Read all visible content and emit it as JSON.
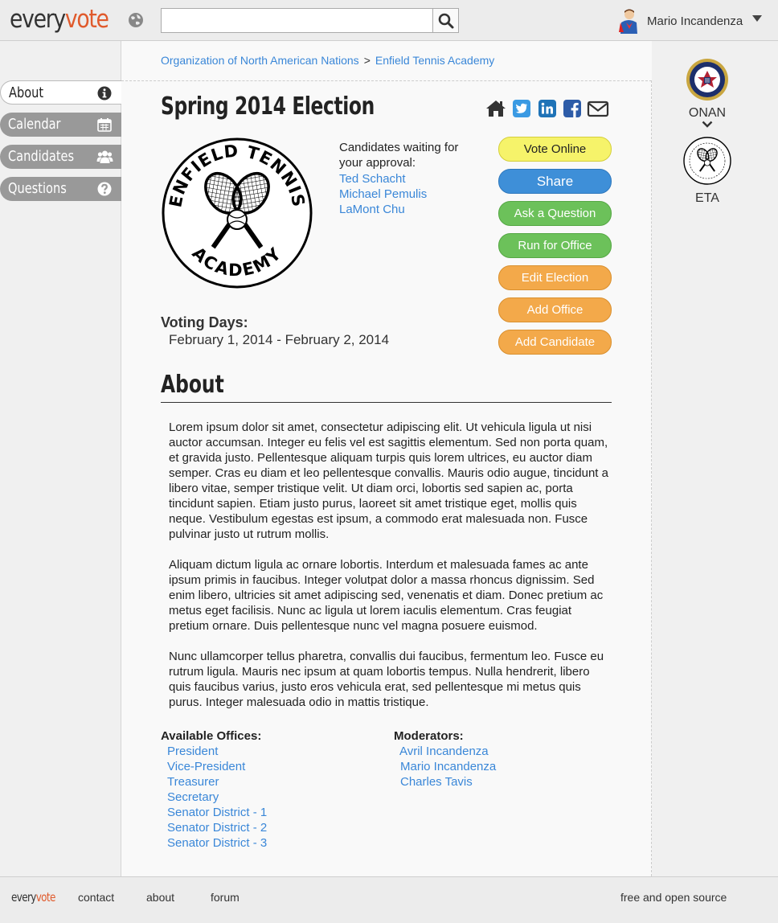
{
  "header": {
    "logo_part1": "every",
    "logo_part2": "vote",
    "search_placeholder": "",
    "user_name": "Mario Incandenza"
  },
  "breadcrumb": {
    "items": [
      "Organization of North American Nations",
      "Enfield Tennis Academy"
    ],
    "separator": ">"
  },
  "nav": {
    "items": [
      {
        "label": "About",
        "icon": "info-icon",
        "active": true
      },
      {
        "label": "Calendar",
        "icon": "calendar-icon",
        "active": false
      },
      {
        "label": "Candidates",
        "icon": "users-icon",
        "active": false
      },
      {
        "label": "Questions",
        "icon": "question-icon",
        "active": false
      }
    ]
  },
  "election": {
    "title": "Spring 2014 Election",
    "logo_text_top": "ENFIELD TENNIS",
    "logo_text_bottom": "ACADEMY",
    "waiting_label": "Candidates waiting for your approval:",
    "waiting_candidates": [
      "Ted Schacht",
      "Michael Pemulis",
      "LaMont Chu"
    ],
    "voting_days_label": "Voting Days:",
    "voting_days": "February 1, 2014 - February 2, 2014"
  },
  "share_icons": [
    "home-icon",
    "twitter-icon",
    "linkedin-icon",
    "facebook-icon",
    "email-icon"
  ],
  "actions": {
    "vote_online": "Vote Online",
    "share": "Share",
    "ask_question": "Ask a Question",
    "run_for_office": "Run for Office",
    "edit_election": "Edit Election",
    "add_office": "Add Office",
    "add_candidate": "Add Candidate"
  },
  "about": {
    "heading": "About",
    "paragraphs": [
      "Lorem ipsum dolor sit amet, consectetur adipiscing elit. Ut vehicula ligula ut nisi auctor accumsan. Integer eu felis vel est sagittis elementum. Sed non porta quam, et gravida justo. Pellentesque aliquam turpis quis lorem ultrices, eu auctor diam semper. Cras eu diam et leo pellentesque convallis. Mauris odio augue, tincidunt a libero vitae, semper tristique velit. Ut diam orci, lobortis sed sapien ac, porta tincidunt sapien. Etiam justo purus, laoreet sit amet tristique eget, mollis quis neque. Vestibulum egestas est ipsum, a commodo erat malesuada non. Fusce pulvinar justo ut rutrum mollis.",
      "Aliquam dictum ligula ac ornare lobortis. Interdum et malesuada fames ac ante ipsum primis in faucibus. Integer volutpat dolor a massa rhoncus dignissim. Sed enim libero, ultricies sit amet adipiscing sed, venenatis et diam. Donec pretium ac metus eget facilisis. Nunc ac ligula ut lorem iaculis elementum. Cras feugiat pretium ornare. Duis pellentesque nunc vel magna posuere euismod.",
      "Nunc ullamcorper tellus pharetra, convallis dui faucibus, fermentum leo. Fusce eu rutrum ligula. Mauris nec ipsum at quam lobortis tempus. Nulla hendrerit, libero quis faucibus varius, justo eros vehicula erat, sed pellentesque mi metus quis purus. Integer malesuada odio in mattis tristique."
    ]
  },
  "offices": {
    "label": "Available Offices:",
    "items": [
      "President",
      "Vice-President",
      "Treasurer",
      "Secretary",
      "Senator District - 1",
      "Senator District - 2",
      "Senator District - 3"
    ]
  },
  "moderators": {
    "label": "Moderators:",
    "items": [
      "Avril Incandenza",
      "Mario Incandenza",
      "Charles Tavis"
    ]
  },
  "orgs": [
    {
      "label": "ONAN"
    },
    {
      "label": "ETA"
    }
  ],
  "footer": {
    "logo_part1": "every",
    "logo_part2": "vote",
    "links": [
      "contact",
      "about",
      "forum"
    ],
    "right_text": "free and open source"
  },
  "colors": {
    "link": "#3a87d8",
    "brand_accent": "#e05a2c",
    "vote_button": "#f6f36a",
    "share_button": "#3e8fd8",
    "green_button": "#6cc15a",
    "orange_button": "#f3a94a",
    "twitter": "#1da1f2",
    "linkedin": "#0077b5",
    "facebook": "#3b5998"
  }
}
